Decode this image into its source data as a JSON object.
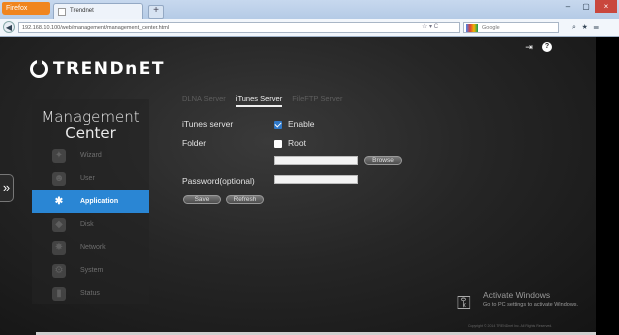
{
  "browser": {
    "app_button": "Firefox",
    "tab_title": "Trendnet",
    "new_tab": "+",
    "window_controls": [
      "–",
      "▢",
      "×"
    ],
    "url": "192.168.10.100/web/management/management_center.html",
    "search_engine": "Google",
    "tool_icons": [
      "search-icon",
      "bookmark-icon",
      "menu-icon"
    ]
  },
  "header": {
    "logo_text": "TRENDnET",
    "logout_icon": "⇥",
    "help_icon": "?"
  },
  "sidebar": {
    "title_line1": "Management",
    "title_line2": "Center",
    "items": [
      {
        "label": "Wizard",
        "icon": "✦"
      },
      {
        "label": "User",
        "icon": "☻"
      },
      {
        "label": "Application",
        "icon": "✱"
      },
      {
        "label": "Disk",
        "icon": "◆"
      },
      {
        "label": "Network",
        "icon": "✸"
      },
      {
        "label": "System",
        "icon": "⚙"
      },
      {
        "label": "Status",
        "icon": "▮"
      }
    ],
    "expand_handle": "»"
  },
  "tabs": [
    "DLNA Server",
    "iTunes Server",
    "FileFTP Server"
  ],
  "form": {
    "itunes_label": "iTunes server",
    "enable_label": "Enable",
    "folder_label": "Folder",
    "root_label": "Root",
    "folder_value": "",
    "browse_label": "Browse",
    "password_label": "Password(optional)",
    "password_value": "",
    "save_label": "Save",
    "refresh_label": "Refresh"
  },
  "watermark": {
    "title": "Activate Windows",
    "subtitle": "Go to PC settings to activate Windows."
  },
  "footer": {
    "copyright": "Copyright © 2014 TRENDnet Inc. All Rights Reserved."
  }
}
